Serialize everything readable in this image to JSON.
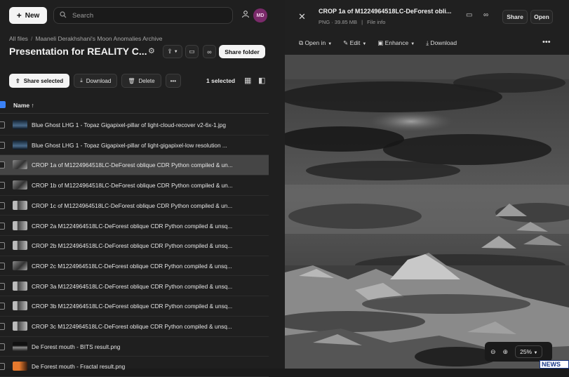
{
  "topbar": {
    "new_label": "New",
    "search_placeholder": "Search",
    "avatar_initials": "MD"
  },
  "breadcrumb": {
    "root": "All files",
    "folder": "Maaneli Derakhshani's Moon Anomalies Archive"
  },
  "folder": {
    "title": "Presentation for REALITY C...",
    "share_label": "Share folder"
  },
  "actions": {
    "share_selected": "Share selected",
    "download": "Download",
    "delete": "Delete",
    "selected_count": "1 selected"
  },
  "columns": {
    "name": "Name"
  },
  "files": [
    {
      "name": "Blue Ghost LHG 1 - Topaz Gigapixel-pillar of light-cloud-recover v2-6x-1.jpg",
      "thumb": "blue"
    },
    {
      "name": "Blue Ghost LHG 1 - Topaz Gigapixel-pillar of light-gigapixel-low resolution ...",
      "thumb": "blue"
    },
    {
      "name": "CROP 1a of M1224964518LC-DeForest oblique CDR Python compiled & un...",
      "thumb": "gray",
      "selected": true
    },
    {
      "name": "CROP 1b of M1224964518LC-DeForest oblique CDR Python compiled & un...",
      "thumb": "gray"
    },
    {
      "name": "CROP 1c of M1224964518LC-DeForest oblique CDR Python compiled & un...",
      "thumb": "flat"
    },
    {
      "name": "CROP 2a M1224964518LC-DeForest oblique CDR Python compiled & unsq...",
      "thumb": "flat"
    },
    {
      "name": "CROP 2b M1224964518LC-DeForest oblique CDR Python compiled & unsq...",
      "thumb": "flat"
    },
    {
      "name": "CROP 2c M1224964518LC-DeForest oblique CDR Python compiled & unsq...",
      "thumb": "gray"
    },
    {
      "name": "CROP 3a M1224964518LC-DeForest oblique CDR Python compiled & unsq...",
      "thumb": "flat"
    },
    {
      "name": "CROP 3b M1224964518LC-DeForest oblique CDR Python compiled & unsq...",
      "thumb": "flat"
    },
    {
      "name": "CROP 3c M1224964518LC-DeForest oblique CDR Python compiled & unsq...",
      "thumb": "flat"
    },
    {
      "name": "De Forest mouth - BITS result.png",
      "thumb": "dark"
    },
    {
      "name": "De Forest mouth - Fractal result.png",
      "thumb": "orange"
    }
  ],
  "preview": {
    "title": "CROP 1a of M1224964518LC-DeForest obli...",
    "filetype": "PNG · 39.85 MB",
    "file_info": "File info",
    "share": "Share",
    "open": "Open",
    "tools": {
      "open_in": "Open in",
      "edit": "Edit",
      "enhance": "Enhance",
      "download": "Download"
    },
    "zoom": "25%"
  },
  "watermark": "NEWS"
}
